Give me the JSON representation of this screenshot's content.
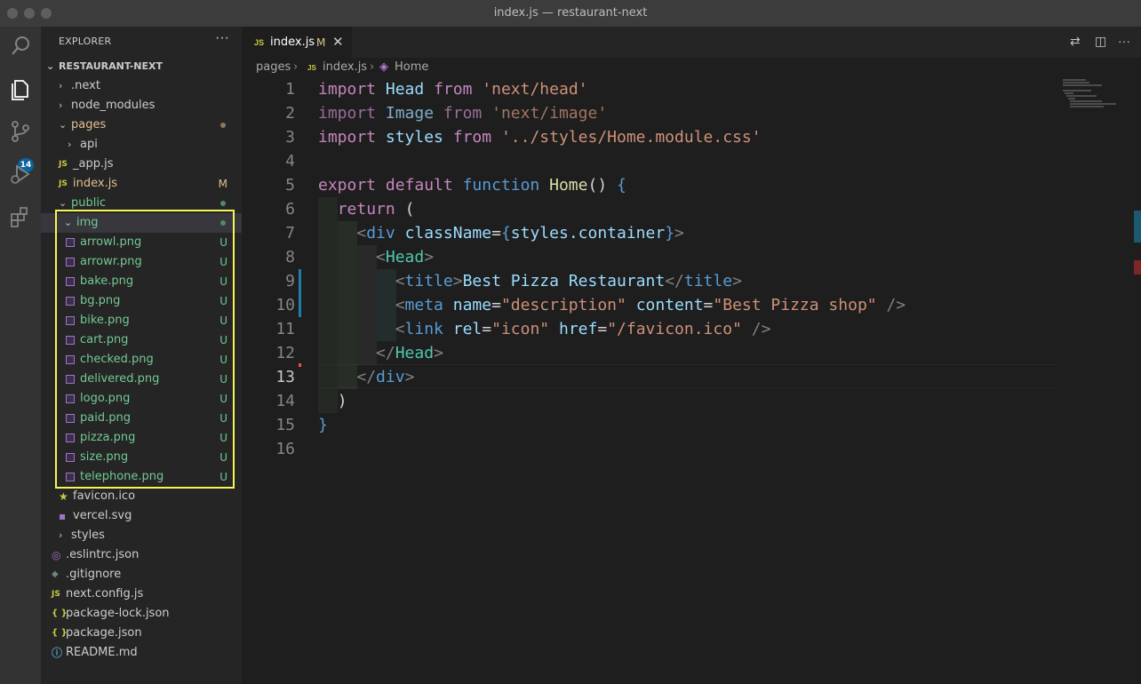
{
  "window": {
    "title": "index.js — restaurant-next"
  },
  "activity": {
    "scm_badge": "14"
  },
  "explorer": {
    "header": "EXPLORER",
    "project": "RESTAURANT-NEXT",
    "items": [
      {
        "name": ".next",
        "type": "folder",
        "expanded": false
      },
      {
        "name": "node_modules",
        "type": "folder",
        "expanded": false
      },
      {
        "name": "pages",
        "type": "folder",
        "expanded": true
      },
      {
        "name": "api",
        "type": "folder",
        "expanded": false
      },
      {
        "name": "_app.js",
        "type": "js"
      },
      {
        "name": "index.js",
        "type": "js",
        "status": "M"
      },
      {
        "name": "public",
        "type": "folder",
        "expanded": true
      },
      {
        "name": "img",
        "type": "folder",
        "expanded": true
      },
      {
        "name": "arrowl.png",
        "type": "image",
        "status": "U"
      },
      {
        "name": "arrowr.png",
        "type": "image",
        "status": "U"
      },
      {
        "name": "bake.png",
        "type": "image",
        "status": "U"
      },
      {
        "name": "bg.png",
        "type": "image",
        "status": "U"
      },
      {
        "name": "bike.png",
        "type": "image",
        "status": "U"
      },
      {
        "name": "cart.png",
        "type": "image",
        "status": "U"
      },
      {
        "name": "checked.png",
        "type": "image",
        "status": "U"
      },
      {
        "name": "delivered.png",
        "type": "image",
        "status": "U"
      },
      {
        "name": "logo.png",
        "type": "image",
        "status": "U"
      },
      {
        "name": "paid.png",
        "type": "image",
        "status": "U"
      },
      {
        "name": "pizza.png",
        "type": "image",
        "status": "U"
      },
      {
        "name": "size.png",
        "type": "image",
        "status": "U"
      },
      {
        "name": "telephone.png",
        "type": "image",
        "status": "U"
      },
      {
        "name": "favicon.ico",
        "type": "favicon"
      },
      {
        "name": "vercel.svg",
        "type": "svg"
      },
      {
        "name": "styles",
        "type": "folder",
        "expanded": false
      },
      {
        "name": ".eslintrc.json",
        "type": "eslint"
      },
      {
        "name": ".gitignore",
        "type": "git"
      },
      {
        "name": "next.config.js",
        "type": "js"
      },
      {
        "name": "package-lock.json",
        "type": "json"
      },
      {
        "name": "package.json",
        "type": "json"
      },
      {
        "name": "README.md",
        "type": "info"
      }
    ]
  },
  "tab": {
    "label": "index.js",
    "status": "M",
    "icon_text": "JS"
  },
  "breadcrumb": {
    "folder": "pages",
    "file": "index.js",
    "symbol": "Home"
  },
  "code": {
    "line_numbers": [
      "1",
      "2",
      "3",
      "4",
      "5",
      "6",
      "7",
      "8",
      "9",
      "10",
      "11",
      "12",
      "13",
      "14",
      "15",
      "16"
    ],
    "lines": [
      "import Head from 'next/head'",
      "import Image from 'next/image'",
      "import styles from '../styles/Home.module.css'",
      "",
      "export default function Home() {",
      "  return (",
      "    <div className={styles.container}>",
      "      <Head>",
      "        <title>Best Pizza Restaurant</title>",
      "        <meta name=\"description\" content=\"Best Pizza shop\" />",
      "        <link rel=\"icon\" href=\"/favicon.ico\" />",
      "      </Head>",
      "    </div>",
      "  )",
      "}",
      ""
    ]
  },
  "colors": {
    "git_added": "#73c991",
    "git_modified": "#e2c08d",
    "highlight": "#f5f556",
    "accent": "#0e639c"
  }
}
